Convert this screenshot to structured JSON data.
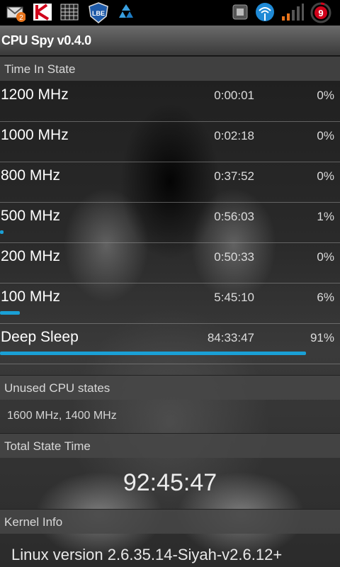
{
  "app": {
    "title": "CPU Spy v0.4.0"
  },
  "status_bar": {
    "notification_badge": "2",
    "lbe_label": "LBE",
    "battery_level": "9",
    "icons": [
      "mail-icon",
      "kaspersky-icon",
      "grid-app-icon",
      "lbe-shield-icon",
      "recycle-icon",
      "usb-debug-icon",
      "wifi-icon",
      "signal-icon",
      "battery-icon"
    ]
  },
  "time_in_state": {
    "header": "Time In State",
    "rows": [
      {
        "freq": "1200 MHz",
        "time": "0:00:01",
        "pct": "0%",
        "fraction": 0.0
      },
      {
        "freq": "1000 MHz",
        "time": "0:02:18",
        "pct": "0%",
        "fraction": 0.0
      },
      {
        "freq": "800 MHz",
        "time": "0:37:52",
        "pct": "0%",
        "fraction": 0.0
      },
      {
        "freq": "500 MHz",
        "time": "0:56:03",
        "pct": "1%",
        "fraction": 0.01
      },
      {
        "freq": "200 MHz",
        "time": "0:50:33",
        "pct": "0%",
        "fraction": 0.0
      },
      {
        "freq": "100 MHz",
        "time": "5:45:10",
        "pct": "6%",
        "fraction": 0.06
      },
      {
        "freq": "Deep Sleep",
        "time": "84:33:47",
        "pct": "91%",
        "fraction": 0.91
      }
    ]
  },
  "unused_states": {
    "header": "Unused CPU states",
    "value": "1600 MHz, 1400 MHz"
  },
  "total_state_time": {
    "header": "Total State Time",
    "value": "92:45:47"
  },
  "kernel_info": {
    "header": "Kernel Info",
    "value": "Linux version 2.6.35.14-Siyah-v2.6.12+"
  },
  "colors": {
    "accent": "#1aa0d6",
    "header_bg": "#464646"
  }
}
